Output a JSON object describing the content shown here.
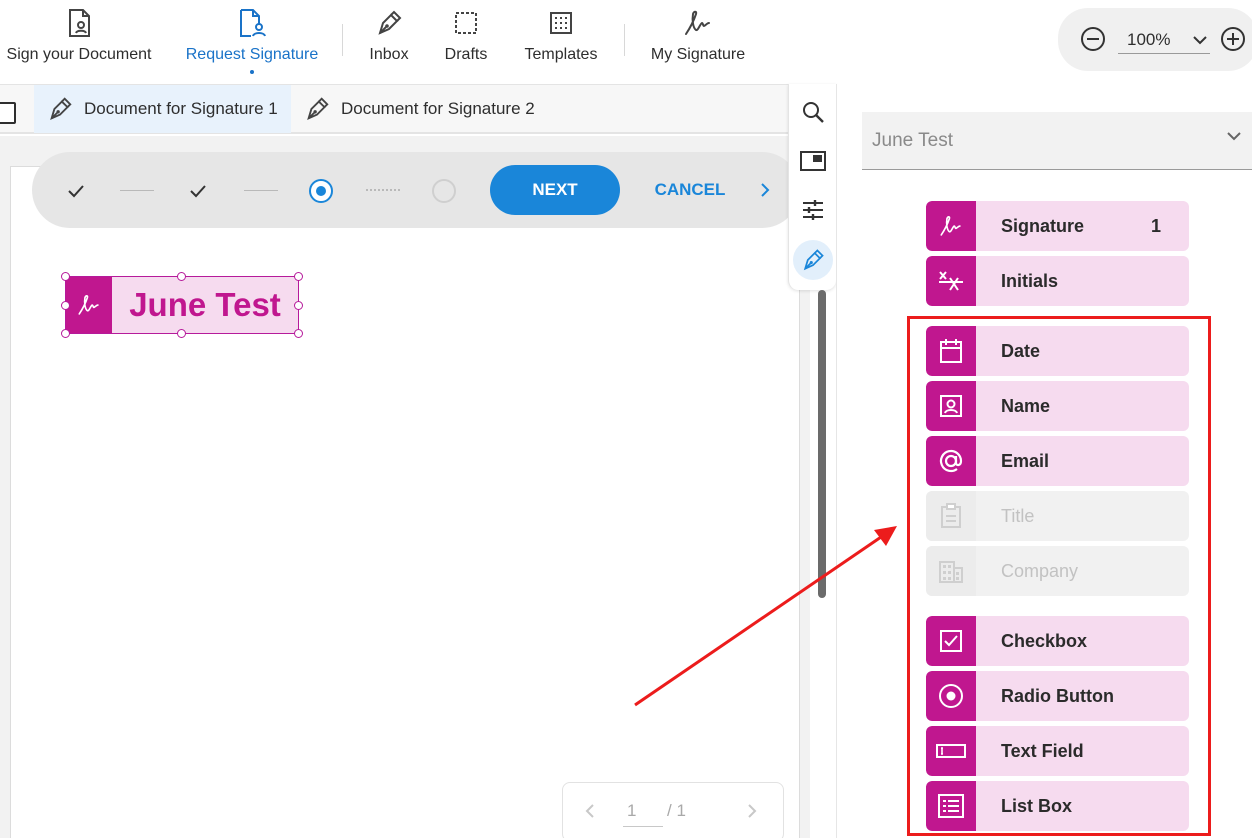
{
  "toolbar": {
    "items": [
      {
        "label": "Sign your Document",
        "icon": "document-sign-icon",
        "active": false
      },
      {
        "label": "Request Signature",
        "icon": "document-request-icon",
        "active": true
      },
      {
        "label": "Inbox",
        "icon": "pen-nib-icon",
        "active": false
      },
      {
        "label": "Drafts",
        "icon": "dashed-square-icon",
        "active": false
      },
      {
        "label": "Templates",
        "icon": "template-grid-icon",
        "active": false
      },
      {
        "label": "My Signature",
        "icon": "signature-scribble-icon",
        "active": false
      }
    ],
    "zoom": {
      "value": "100%"
    }
  },
  "tabs": [
    {
      "label": "Document for Signature 1",
      "active": true
    },
    {
      "label": "Document for Signature 2",
      "active": false
    }
  ],
  "stepper": {
    "steps": [
      "done",
      "done",
      "current",
      "pending"
    ],
    "next_label": "NEXT",
    "cancel_label": "CANCEL"
  },
  "placed_field": {
    "text": "June Test"
  },
  "pager": {
    "current": "1",
    "total": "/ 1"
  },
  "rail": [
    "search-icon",
    "panel-icon",
    "sliders-icon",
    "pen-nib-icon"
  ],
  "panel": {
    "signer": "June Test",
    "fields": [
      {
        "label": "Signature",
        "count": "1",
        "icon": "signature-icon",
        "enabled": true
      },
      {
        "label": "Initials",
        "icon": "initials-icon",
        "enabled": true
      },
      {
        "label": "Date",
        "icon": "calendar-icon",
        "enabled": true
      },
      {
        "label": "Name",
        "icon": "person-badge-icon",
        "enabled": true
      },
      {
        "label": "Email",
        "icon": "at-sign-icon",
        "enabled": true
      },
      {
        "label": "Title",
        "icon": "clipboard-icon",
        "enabled": false
      },
      {
        "label": "Company",
        "icon": "building-icon",
        "enabled": false
      },
      {
        "label": "Checkbox",
        "icon": "checkbox-icon",
        "enabled": true
      },
      {
        "label": "Radio Button",
        "icon": "radio-icon",
        "enabled": true
      },
      {
        "label": "Text Field",
        "icon": "text-field-icon",
        "enabled": true
      },
      {
        "label": "List Box",
        "icon": "list-box-icon",
        "enabled": true
      }
    ]
  },
  "colors": {
    "accent": "#1a86d9",
    "field": "#c0178f",
    "field_bg": "#f6dbef",
    "annotation": "#ec1c1c"
  }
}
